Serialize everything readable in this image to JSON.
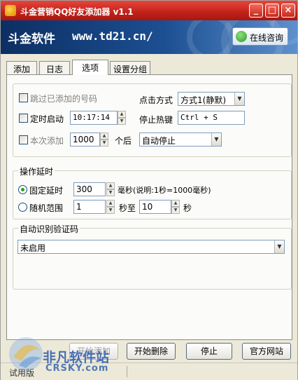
{
  "window": {
    "title": "斗金营销QQ好友添加器 v1.1",
    "controls": {
      "minimize": "_",
      "maximize": "□",
      "close": "×"
    }
  },
  "banner": {
    "brand": "斗金软件",
    "url": "www.td21.cn/",
    "consult_label": "在线咨询"
  },
  "tabs": [
    {
      "label": "添加"
    },
    {
      "label": "日志"
    },
    {
      "label": "选项",
      "active": true
    },
    {
      "label": "设置分组"
    }
  ],
  "options": {
    "skip_added_label": "跳过已添加的号码",
    "timed_start_label": "定时启动",
    "timed_start_value": "10:17:14",
    "add_count_label": "本次添加",
    "add_count_value": "1000",
    "add_count_unit": "个后",
    "after_action_value": "自动停止",
    "click_mode_label": "点击方式",
    "click_mode_value": "方式1(静默)",
    "stop_hotkey_label": "停止热键",
    "stop_hotkey_value": "Ctrl + S"
  },
  "delay": {
    "group_title": "操作延时",
    "fixed_label": "固定延时",
    "fixed_value": "300",
    "fixed_unit": "毫秒(说明:1秒=1000毫秒)",
    "random_label": "随机范围",
    "random_from": "1",
    "random_mid": "秒至",
    "random_to": "10",
    "random_unit": "秒",
    "selected": "fixed"
  },
  "captcha": {
    "group_title": "自动识别验证码",
    "value": "未启用"
  },
  "buttons": {
    "start_add": "开始添加",
    "start_delete": "开始删除",
    "stop": "停止",
    "official_site": "官方网站"
  },
  "status": {
    "text": "试用版"
  },
  "watermark": {
    "brand": "非凡软件站",
    "domain": "CRSKY.com"
  },
  "colors": {
    "title_bar": "#c0221a",
    "banner": "#1c4f92",
    "window_bg": "#ece9d8"
  }
}
